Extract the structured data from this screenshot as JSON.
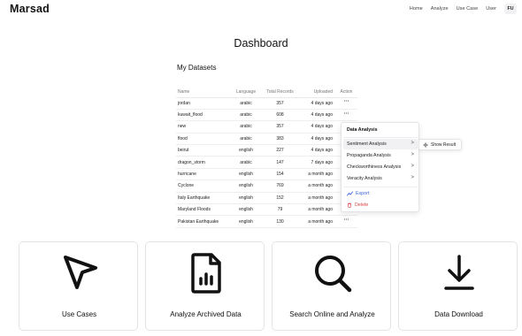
{
  "app": {
    "brand": "Marsad"
  },
  "nav": {
    "links": [
      "Home",
      "Analyze",
      "Use Case",
      "User"
    ],
    "avatar": "FU"
  },
  "page": {
    "title": "Dashboard",
    "section_title": "My Datasets"
  },
  "table": {
    "headers": [
      "Name",
      "Language",
      "Total Records",
      "Uploaded",
      "Action"
    ],
    "action_label": "···",
    "rows": [
      {
        "name": "jordan",
        "language": "arabic",
        "records": "357",
        "uploaded": "4 days ago"
      },
      {
        "name": "kuwait_flood",
        "language": "arabic",
        "records": "608",
        "uploaded": "4 days ago"
      },
      {
        "name": "new",
        "language": "arabic",
        "records": "357",
        "uploaded": "4 days ago"
      },
      {
        "name": "flood",
        "language": "arabic",
        "records": "383",
        "uploaded": "4 days ago"
      },
      {
        "name": "beirut",
        "language": "english",
        "records": "227",
        "uploaded": "4 days ago"
      },
      {
        "name": "dragon_storm",
        "language": "arabic",
        "records": "147",
        "uploaded": "7 days ago"
      },
      {
        "name": "hurricane",
        "language": "english",
        "records": "154",
        "uploaded": "a month ago"
      },
      {
        "name": "Cyclone",
        "language": "english",
        "records": "769",
        "uploaded": "a month ago"
      },
      {
        "name": "Italy Earthquake",
        "language": "english",
        "records": "152",
        "uploaded": "a month ago"
      },
      {
        "name": "Maryland Floods",
        "language": "english",
        "records": "79",
        "uploaded": "a month ago"
      },
      {
        "name": "Pakistan Earthquake",
        "language": "english",
        "records": "130",
        "uploaded": "a month ago"
      }
    ]
  },
  "menu": {
    "header": "Data Analysis",
    "items": [
      {
        "label": "Sentiment Analysis",
        "chevron": ">"
      },
      {
        "label": "Propaganda Analysis",
        "chevron": ">"
      },
      {
        "label": "Checkworthiness Analysis",
        "chevron": ">"
      },
      {
        "label": "Veracity Analysis",
        "chevron": ">"
      }
    ],
    "export": "Export",
    "delete": "Delete"
  },
  "submenu": {
    "item": "Show Result"
  },
  "cards": [
    {
      "label": "Use Cases",
      "icon": "cursor-arrow-icon"
    },
    {
      "label": "Analyze Archived Data",
      "icon": "document-chart-icon"
    },
    {
      "label": "Search Online and Analyze",
      "icon": "search-icon"
    },
    {
      "label": "Data Download",
      "icon": "download-icon"
    }
  ],
  "colors": {
    "export": "#3b63d6",
    "delete": "#d64545",
    "highlight": "#f1f1f3",
    "border": "#e4e4e7"
  }
}
